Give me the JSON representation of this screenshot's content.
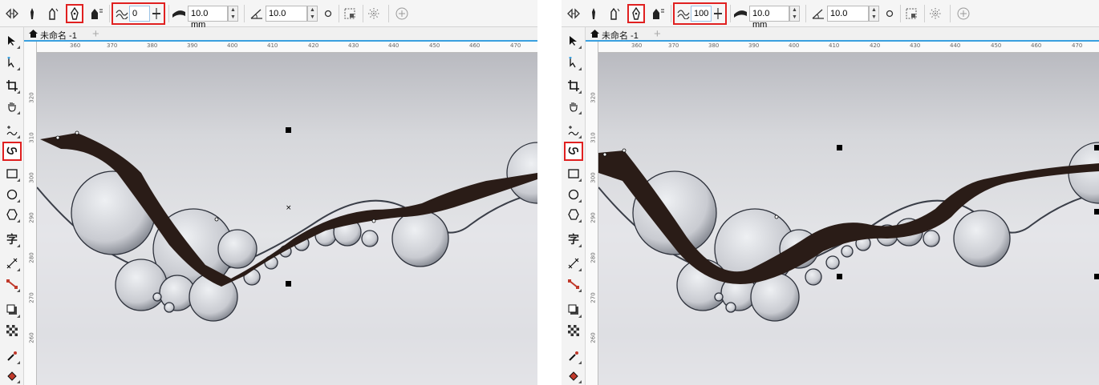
{
  "panels": [
    {
      "toolbar": {
        "smoothing_value": "0",
        "width_value": "10.0 mm",
        "angle_value": "10.0"
      },
      "document_tab": {
        "label": "未命名 -1"
      },
      "ruler": {
        "horizontal": [
          "360",
          "370",
          "380",
          "390",
          "400",
          "410",
          "420",
          "430",
          "440",
          "450",
          "460",
          "470"
        ],
        "vertical": [
          "300",
          "320",
          "310",
          "300",
          "290",
          "280",
          "270",
          "260"
        ]
      }
    },
    {
      "toolbar": {
        "smoothing_value": "100",
        "width_value": "10.0 mm",
        "angle_value": "10.0"
      },
      "document_tab": {
        "label": "未命名 -1"
      },
      "ruler": {
        "horizontal": [
          "360",
          "370",
          "380",
          "390",
          "400",
          "410",
          "420",
          "430",
          "440",
          "450",
          "460",
          "470"
        ],
        "vertical": [
          "300",
          "320",
          "310",
          "300",
          "290",
          "280",
          "270",
          "260"
        ]
      }
    }
  ],
  "icons": {
    "node": "node-tool-icon",
    "brush": "brush-stroke-icon",
    "calligraphic": "calligraphic-pen-icon",
    "smoothing": "smoothing-icon",
    "width": "nib-width-icon",
    "angle": "nib-angle-icon"
  },
  "colors": {
    "highlight_box": "#e02020",
    "tab_underline": "#3aa0e0",
    "stroke_fill": "#2a1c17"
  }
}
